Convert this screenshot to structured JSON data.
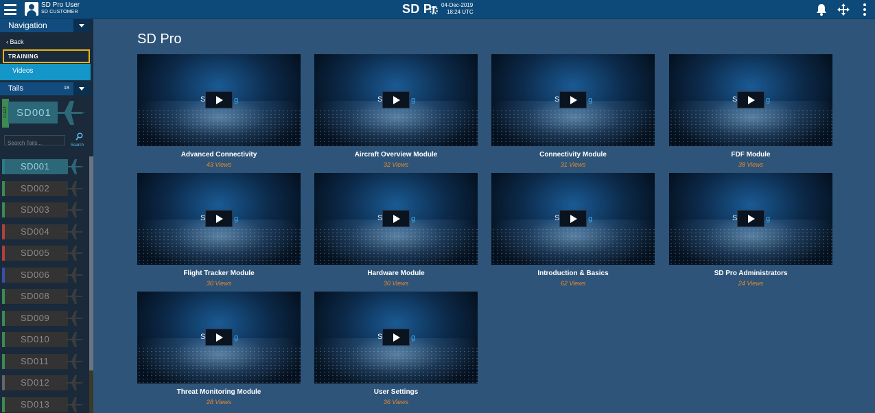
{
  "topbar": {
    "user_name": "SD Pro User",
    "user_role": "SD CUSTOMER",
    "brand": "SD Pr",
    "date": "04-Dec-2019",
    "time": "18:24 UTC"
  },
  "sidebar": {
    "nav_label": "Navigation",
    "back_label": "Back",
    "section_label": "TRAINING",
    "active_item": "Videos",
    "tails_label": "Tails",
    "tails_count": "18",
    "fleet_tab": "FLEET",
    "selected_tail": "SD001",
    "search_placeholder": "Search Tails...",
    "search_label": "Search",
    "tails": [
      {
        "id": "SD001",
        "stripe": "#2f7a86",
        "active": true
      },
      {
        "id": "SD002",
        "stripe": "#3d8a52",
        "active": false
      },
      {
        "id": "SD003",
        "stripe": "#3d8a52",
        "active": false
      },
      {
        "id": "SD004",
        "stripe": "#b0403a",
        "active": false
      },
      {
        "id": "SD005",
        "stripe": "#b0403a",
        "active": false
      },
      {
        "id": "SD006",
        "stripe": "#3a4fa8",
        "active": false
      },
      {
        "id": "SD008",
        "stripe": "#3d8a52",
        "active": false
      },
      {
        "id": "SD009",
        "stripe": "#3d8a52",
        "active": false
      },
      {
        "id": "SD010",
        "stripe": "#3d8a52",
        "active": false
      },
      {
        "id": "SD011",
        "stripe": "#3d8a52",
        "active": false
      },
      {
        "id": "SD012",
        "stripe": "#666666",
        "active": false
      },
      {
        "id": "SD013",
        "stripe": "#3d8a52",
        "active": false
      }
    ]
  },
  "main": {
    "title": "SD Pro",
    "thumb_logo_left": "SD",
    "thumb_logo_right": "g",
    "videos": [
      {
        "title": "Advanced Connectivity",
        "views": "43 Views"
      },
      {
        "title": "Aircraft Overview Module",
        "views": "32 Views"
      },
      {
        "title": "Connectivity Module",
        "views": "31 Views"
      },
      {
        "title": "FDF Module",
        "views": "38 Views"
      },
      {
        "title": "Flight Tracker Module",
        "views": "30 Views"
      },
      {
        "title": "Hardware Module",
        "views": "30 Views"
      },
      {
        "title": "Introduction & Basics",
        "views": "62 Views"
      },
      {
        "title": "SD Pro Administrators",
        "views": "24 Views"
      },
      {
        "title": "Threat Monitoring Module",
        "views": "28 Views"
      },
      {
        "title": "User Settings",
        "views": "36 Views"
      }
    ]
  },
  "colors": {
    "topbar": "#0d4a7a",
    "content_bg": "#2e5479",
    "sidebar_bg": "#1a2a3a",
    "highlight": "#e8b416",
    "active_item": "#1496c8",
    "views_text": "#e88a2e"
  }
}
